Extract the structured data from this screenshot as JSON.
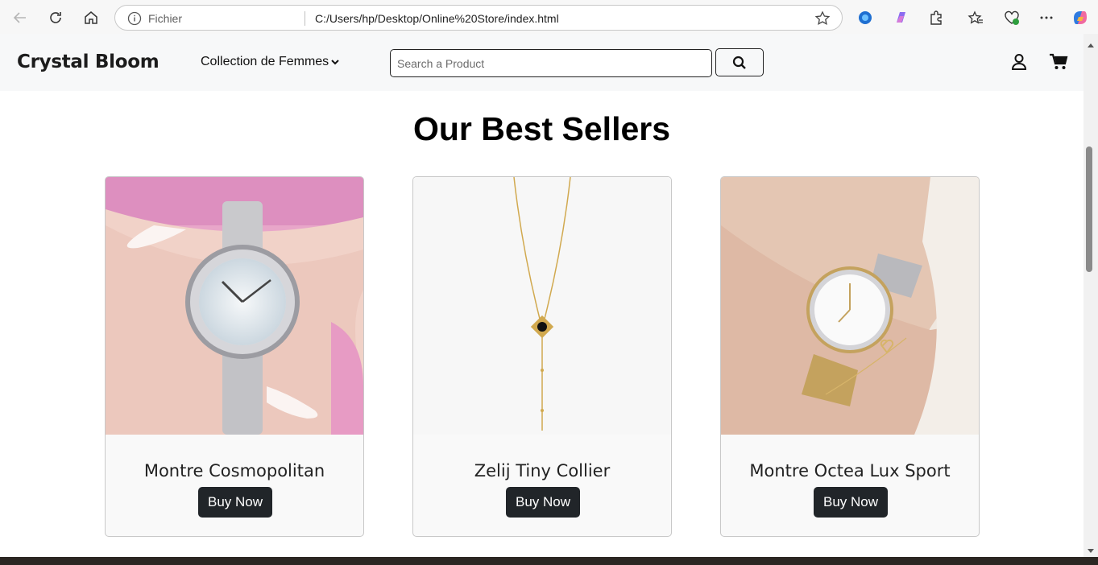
{
  "browser": {
    "scheme_label": "Fichier",
    "url": "C:/Users/hp/Desktop/Online%20Store/index.html"
  },
  "header": {
    "logo": "Crystal Bloom",
    "collection_label": "Collection de Femmes",
    "search_placeholder": "Search a Product"
  },
  "main": {
    "title": "Our Best Sellers",
    "products": [
      {
        "name": "Montre Cosmopolitan",
        "button": "Buy Now"
      },
      {
        "name": "Zelij Tiny Collier",
        "button": "Buy Now"
      },
      {
        "name": "Montre Octea Lux Sport",
        "button": "Buy Now"
      }
    ]
  },
  "colors": {
    "header_bg": "#f7f8f9",
    "button_dark": "#212529",
    "card_bg": "#f9f9f9"
  }
}
